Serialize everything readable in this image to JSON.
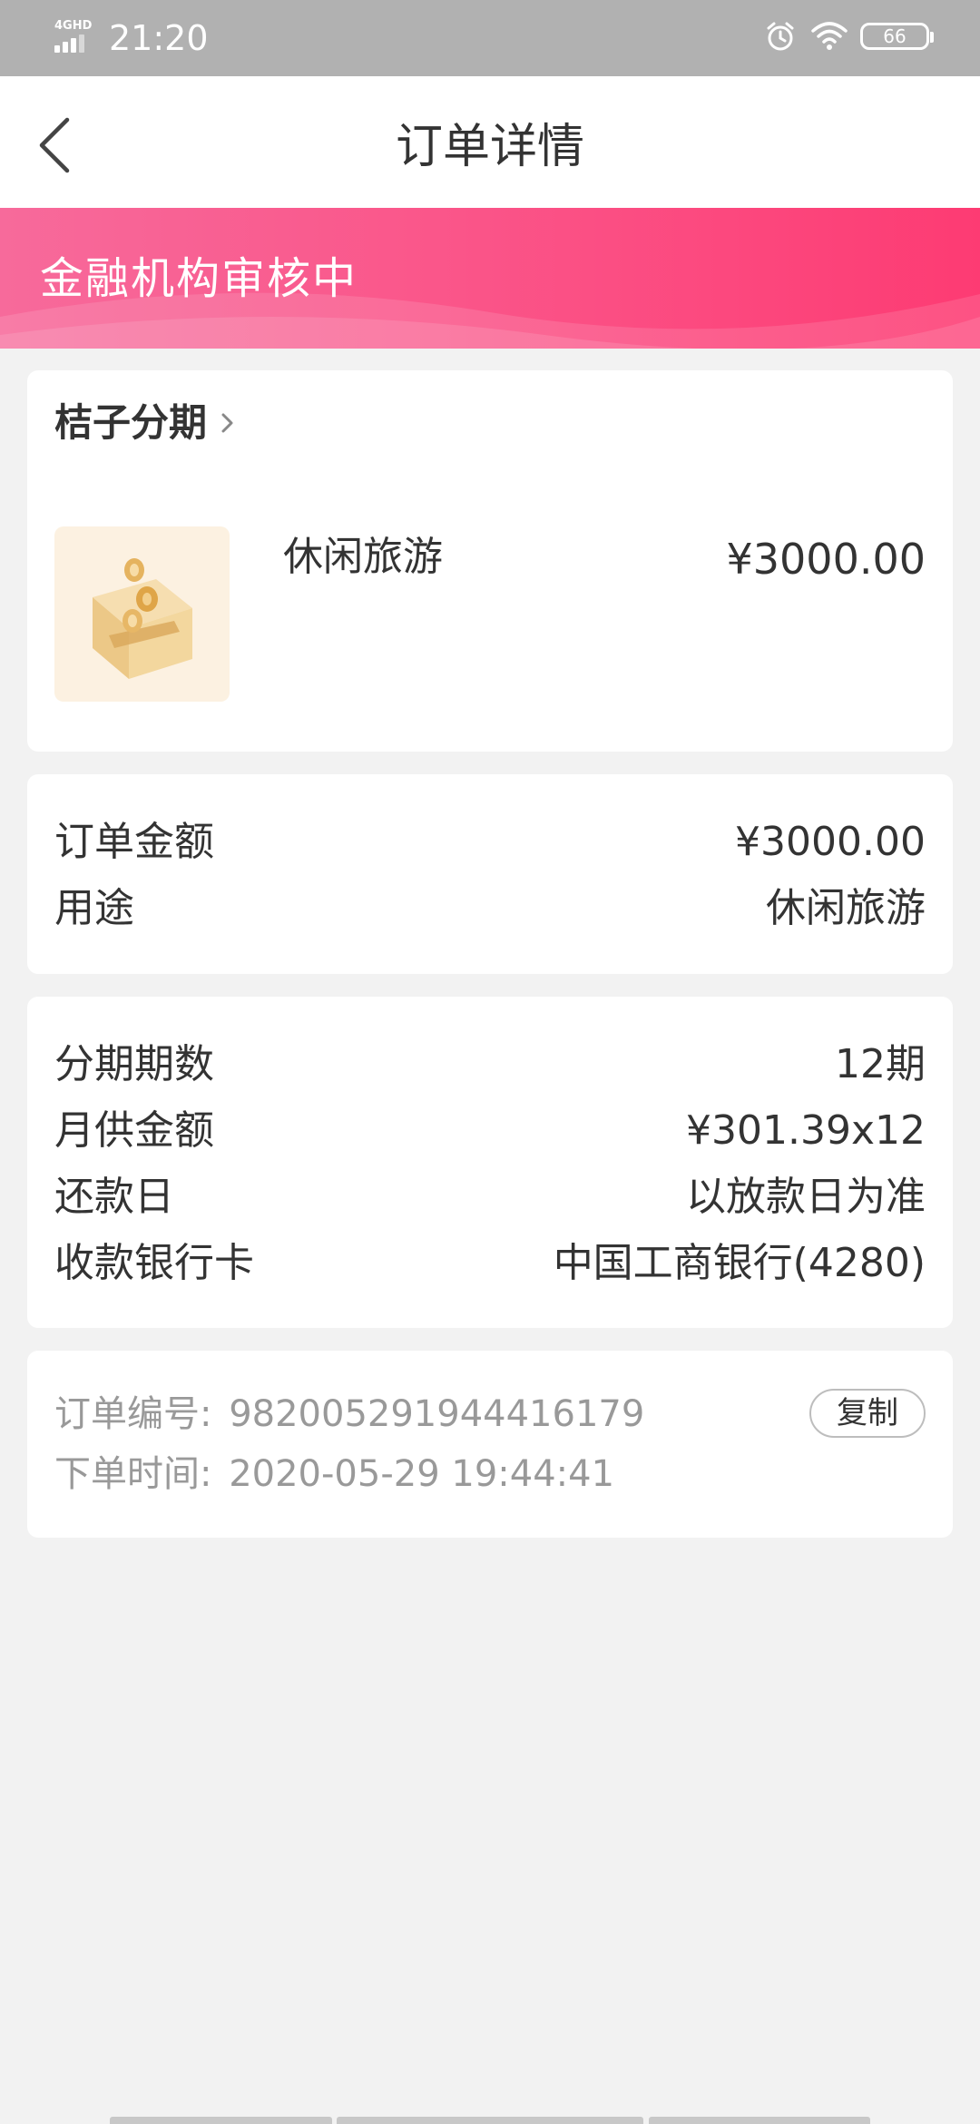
{
  "status_bar": {
    "network": "4GHD",
    "time": "21:20",
    "battery": "66"
  },
  "header": {
    "title": "订单详情"
  },
  "banner": {
    "status_text": "金融机构审核中"
  },
  "product_card": {
    "store_name": "桔子分期",
    "product_name": "休闲旅游",
    "price": "¥3000.00"
  },
  "order_summary": {
    "rows": [
      {
        "label": "订单金额",
        "value": "¥3000.00"
      },
      {
        "label": "用途",
        "value": "休闲旅游"
      }
    ]
  },
  "installment": {
    "rows": [
      {
        "label": "分期期数",
        "value": "12期"
      },
      {
        "label": "月供金额",
        "value": "¥301.39x12"
      },
      {
        "label": "还款日",
        "value": "以放款日为准"
      },
      {
        "label": "收款银行卡",
        "value": "中国工商银行(4280)"
      }
    ]
  },
  "order_meta": {
    "order_no_label": "订单编号:",
    "order_no": "982005291944416179",
    "order_time_label": "下单时间:",
    "order_time": "2020-05-29 19:44:41",
    "copy_label": "复制"
  },
  "colors": {
    "banner_start": "#f76a9b",
    "banner_end": "#fd3b73",
    "background": "#f2f2f2"
  }
}
